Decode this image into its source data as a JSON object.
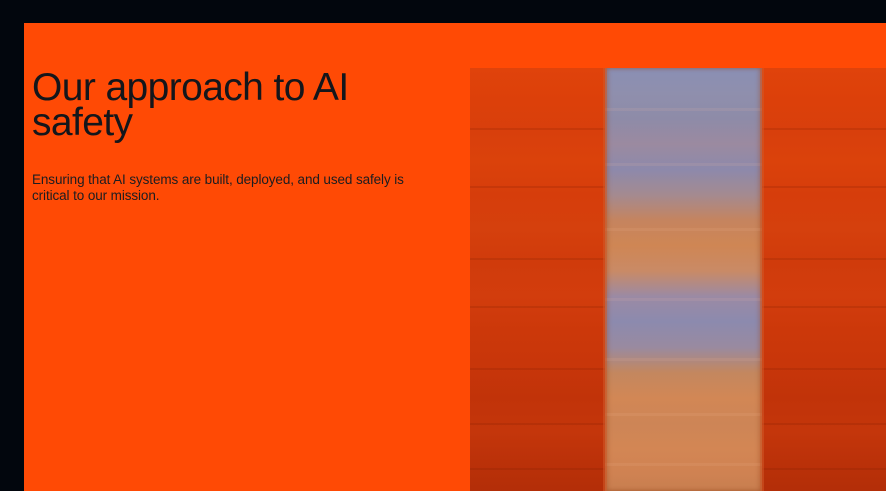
{
  "hero": {
    "title": "Our approach to AI safety",
    "subtitle": "Ensuring that AI systems are built, deployed, and used safely is critical to our mission."
  },
  "colors": {
    "page_background": "#02060d",
    "panel_background": "#ff4a05",
    "text": "#14161b",
    "artwork_stripe": "#8c8aae"
  }
}
